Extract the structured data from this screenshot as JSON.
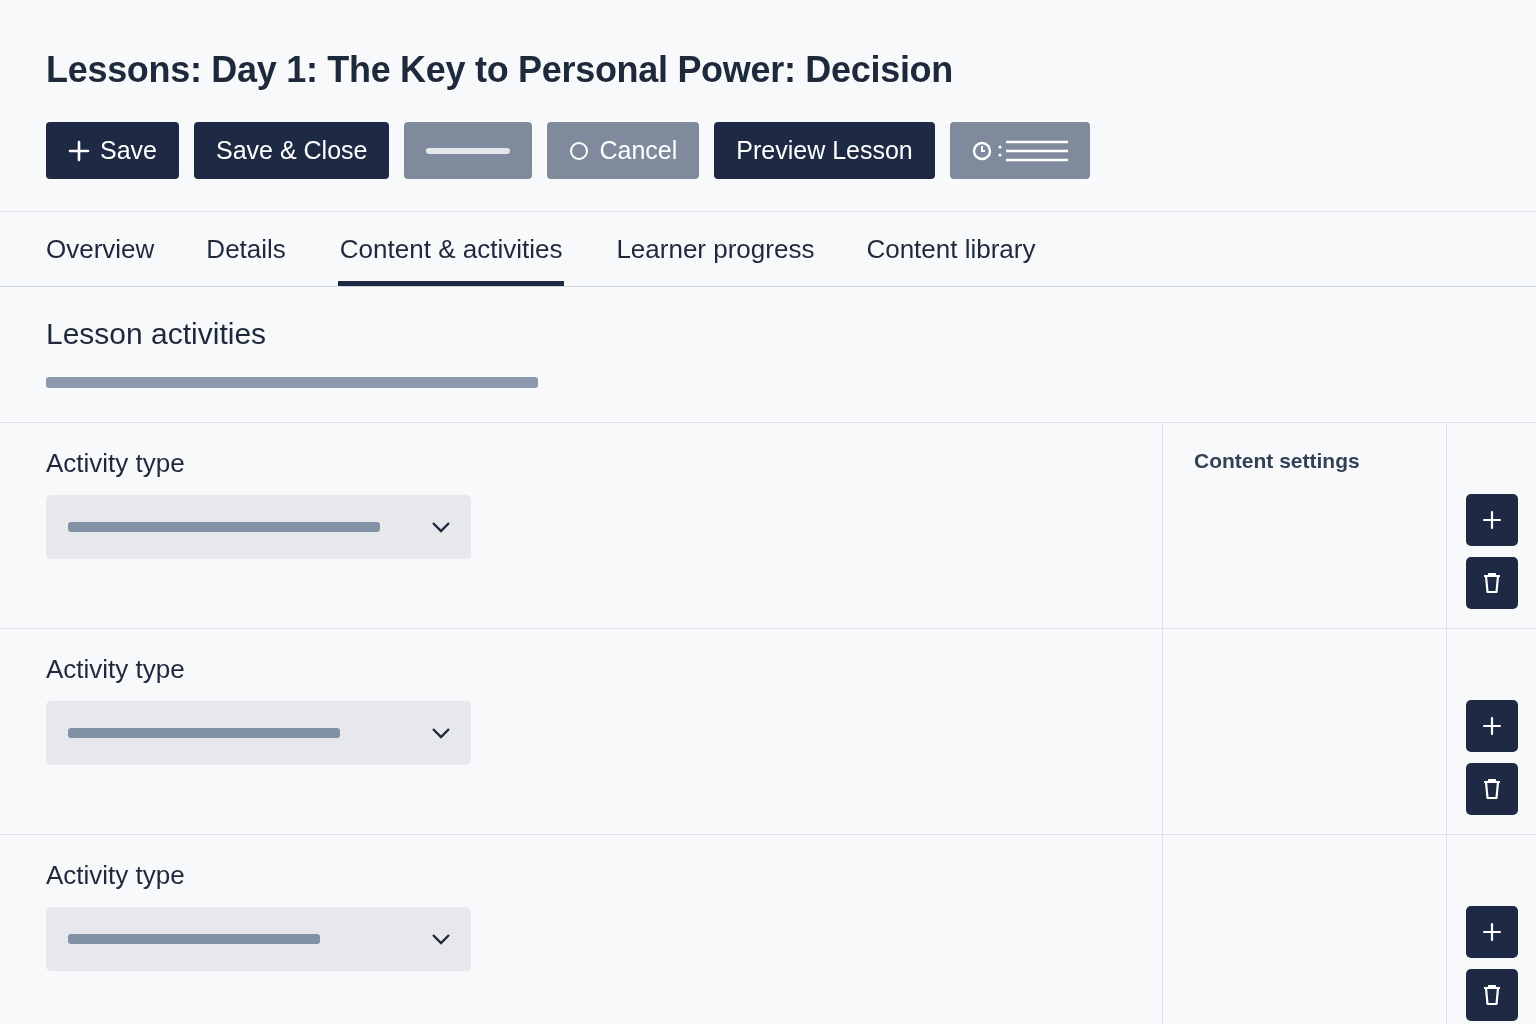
{
  "title": "Lessons: Day 1: The Key to Personal Power: Decision",
  "toolbar": [
    {
      "kind": "add",
      "label": "Save"
    },
    {
      "kind": "primary",
      "label": "Save & Close"
    },
    {
      "kind": "blank"
    },
    {
      "kind": "cancel",
      "label": "Cancel"
    },
    {
      "kind": "primary",
      "label": "Preview Lesson"
    },
    {
      "kind": "schedule"
    }
  ],
  "tabs": [
    {
      "label": "Overview",
      "selected": false
    },
    {
      "label": "Details",
      "selected": false
    },
    {
      "label": "Content & activities",
      "selected": true
    },
    {
      "label": "Learner progress",
      "selected": false
    },
    {
      "label": "Content library",
      "selected": false
    }
  ],
  "section": {
    "title": "Lesson activities"
  },
  "activities": [
    {
      "label": "Activity type",
      "settings_label": "Content settings"
    },
    {
      "label": "Activity type"
    },
    {
      "label": "Activity type"
    }
  ]
}
